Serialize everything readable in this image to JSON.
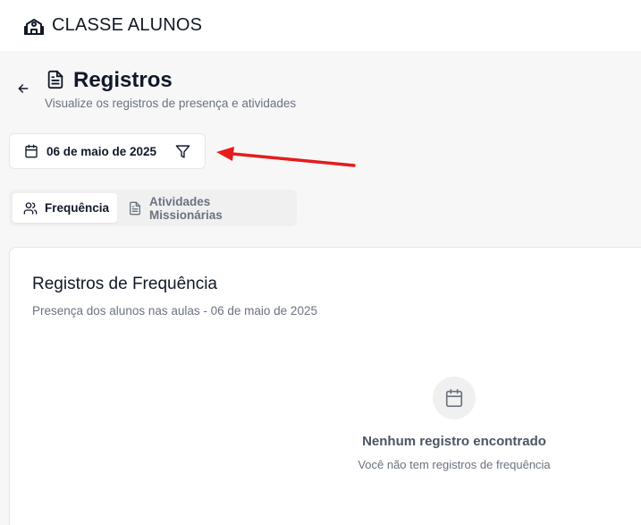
{
  "app": {
    "brand": "CLASSE ALUNOS",
    "brand_icon": "school-icon"
  },
  "header": {
    "back_icon": "arrow-left-icon",
    "title_icon": "file-text-icon",
    "title": "Registros",
    "subtitle": "Visualize os registros de presença e atividades"
  },
  "filter": {
    "date_label": "06 de maio de 2025",
    "calendar_icon": "calendar-icon",
    "filter_icon": "filter-icon"
  },
  "annotation": {
    "arrow_color": "#e51c1c"
  },
  "tabs": [
    {
      "label": "Frequência",
      "icon": "users-icon",
      "active": true
    },
    {
      "label": "Atividades Missionárias",
      "icon": "file-text-icon",
      "active": false
    }
  ],
  "card": {
    "title": "Registros de Frequência",
    "subtitle": "Presença dos alunos nas aulas - 06 de maio de 2025",
    "empty": {
      "icon": "calendar-icon",
      "title": "Nenhum registro encontrado",
      "description": "Você não tem registros de frequência"
    }
  }
}
